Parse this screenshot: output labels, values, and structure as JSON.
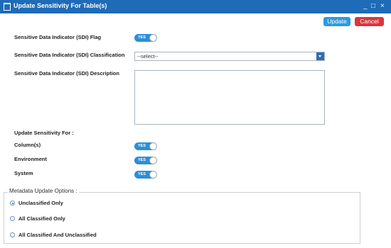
{
  "window": {
    "title": "Update Sensitivity For Table(s)",
    "controls": [
      "_",
      "□",
      "×"
    ]
  },
  "toolbar": {
    "update_label": "Update",
    "cancel_label": "Cancel"
  },
  "sdi": {
    "flag_label": "Sensitive Data Indicator (SDI) Flag",
    "flag_value": "YES",
    "classification_label": "Sensitive Data Indicator (SDI) Classification",
    "classification_value": "--select--",
    "description_label": "Sensitive Data Indicator (SDI) Description",
    "description_value": ""
  },
  "update_for": {
    "heading": "Update Sensitivity For :",
    "items": [
      {
        "label": "Column(s)",
        "value": "YES"
      },
      {
        "label": "Environment",
        "value": "YES"
      },
      {
        "label": "System",
        "value": "YES"
      }
    ]
  },
  "metadata": {
    "legend": "Metadata Update Options :",
    "options": [
      {
        "label": "Unclassified Only",
        "checked": true
      },
      {
        "label": "All Classified Only",
        "checked": false
      },
      {
        "label": "All Classified And Unclassified",
        "checked": false
      }
    ]
  },
  "colors": {
    "titlebar": "#1e6bb8",
    "accent": "#2b8fd6",
    "update": "#2b9be0",
    "cancel": "#d9363e"
  },
  "icons": {
    "window": "window-icon",
    "minimize": "minimize-icon",
    "maximize": "maximize-icon",
    "close": "close-icon",
    "dropdown": "chevron-down-icon"
  }
}
